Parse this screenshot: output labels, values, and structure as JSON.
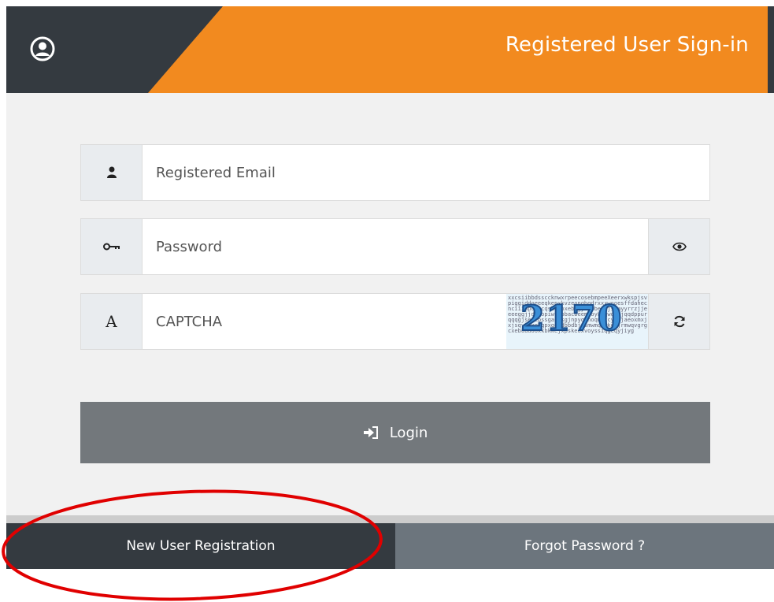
{
  "header": {
    "title": "Registered User Sign-in",
    "icon": "user-circle-icon",
    "accent_color": "#f28a1f",
    "dark_color": "#343a40"
  },
  "form": {
    "email": {
      "placeholder": "Registered Email",
      "value": "",
      "icon": "user-icon"
    },
    "password": {
      "placeholder": "Password",
      "value": "",
      "icon": "key-icon",
      "toggle_icon": "eye-icon"
    },
    "captcha": {
      "placeholder": "CAPTCHA",
      "value": "",
      "icon_label": "A",
      "image_text": "2170",
      "refresh_icon": "refresh-icon"
    },
    "login_label": "Login",
    "login_icon": "sign-in-icon"
  },
  "footer": {
    "register_label": "New User Registration",
    "forgot_label": "Forgot Password ?"
  },
  "annotation": {
    "type": "red-ellipse",
    "color": "#e00000"
  }
}
